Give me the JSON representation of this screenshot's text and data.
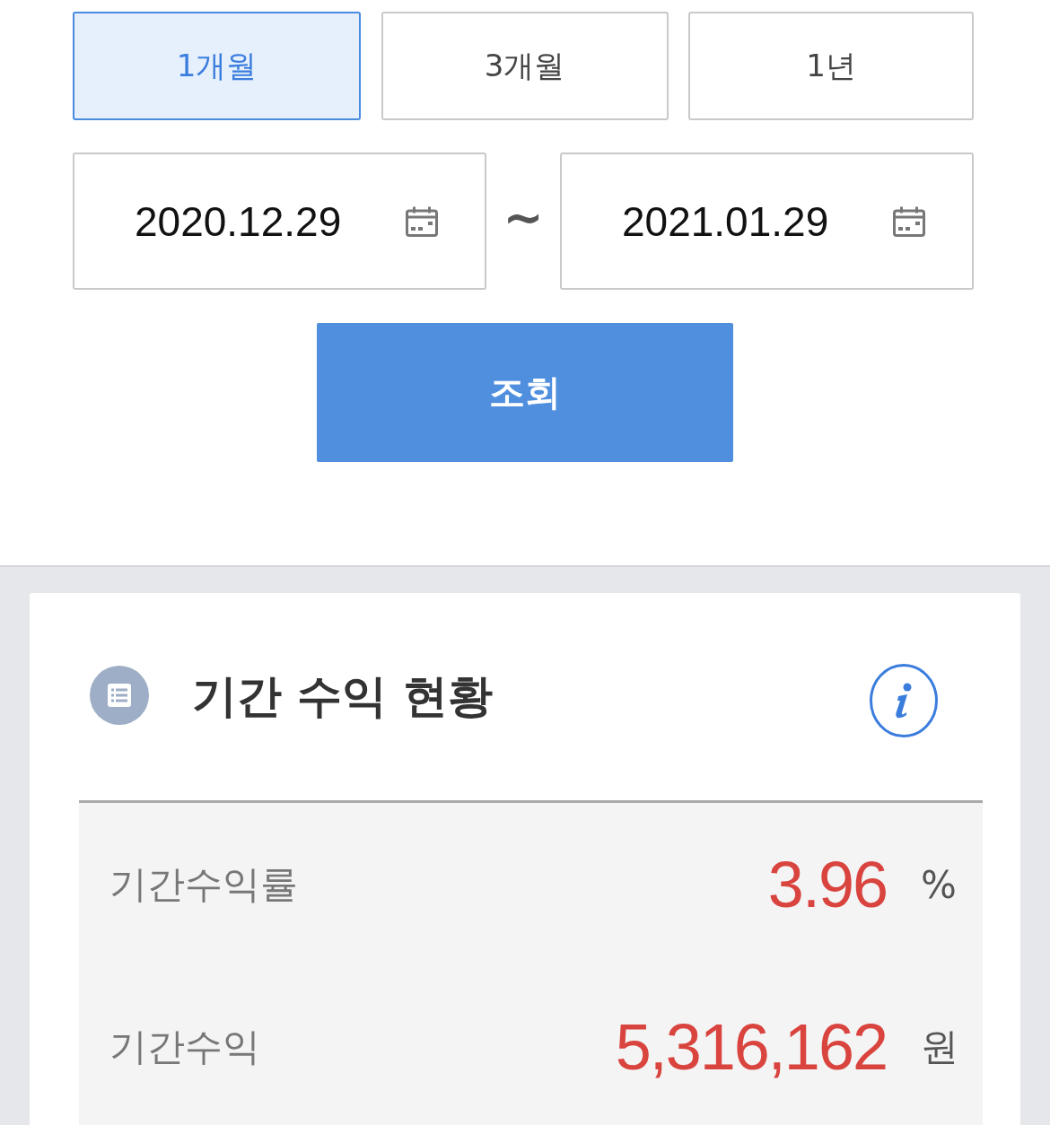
{
  "period_tabs": [
    {
      "label": "1개월",
      "selected": true
    },
    {
      "label": "3개월",
      "selected": false
    },
    {
      "label": "1년",
      "selected": false
    }
  ],
  "date_range": {
    "start": "2020.12.29",
    "separator": "~",
    "end": "2021.01.29"
  },
  "search_button": "조회",
  "summary_card": {
    "title": "기간 수익 현황",
    "rows": [
      {
        "label": "기간수익률",
        "value": "3.96",
        "unit": "%"
      },
      {
        "label": "기간수익",
        "value": "5,316,162",
        "unit": "원"
      }
    ]
  }
}
